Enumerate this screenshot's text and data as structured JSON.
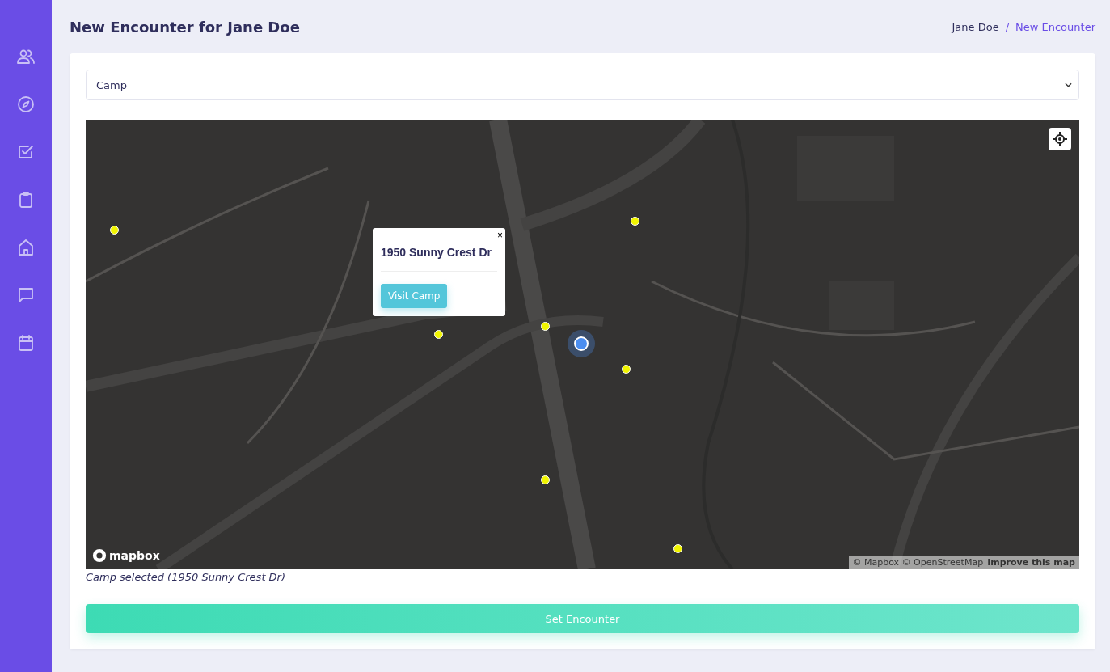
{
  "page_title": "New Encounter for Jane Doe",
  "breadcrumb": [
    {
      "label": "Jane Doe",
      "selected": false
    },
    {
      "label": "New Encounter",
      "selected": true
    }
  ],
  "breadcrumb_separator": "/",
  "type_select": {
    "value": "Camp"
  },
  "map": {
    "popup": {
      "title": "1950 Sunny Crest Dr",
      "close": "×",
      "button": "Visit Camp"
    },
    "logo": "mapbox",
    "attribution": "© Mapbox © OpenStreetMap",
    "improve_link": "Improve this map"
  },
  "selection_note": "Camp selected (1950 Sunny Crest Dr)",
  "submit_button": "Set Encounter"
}
